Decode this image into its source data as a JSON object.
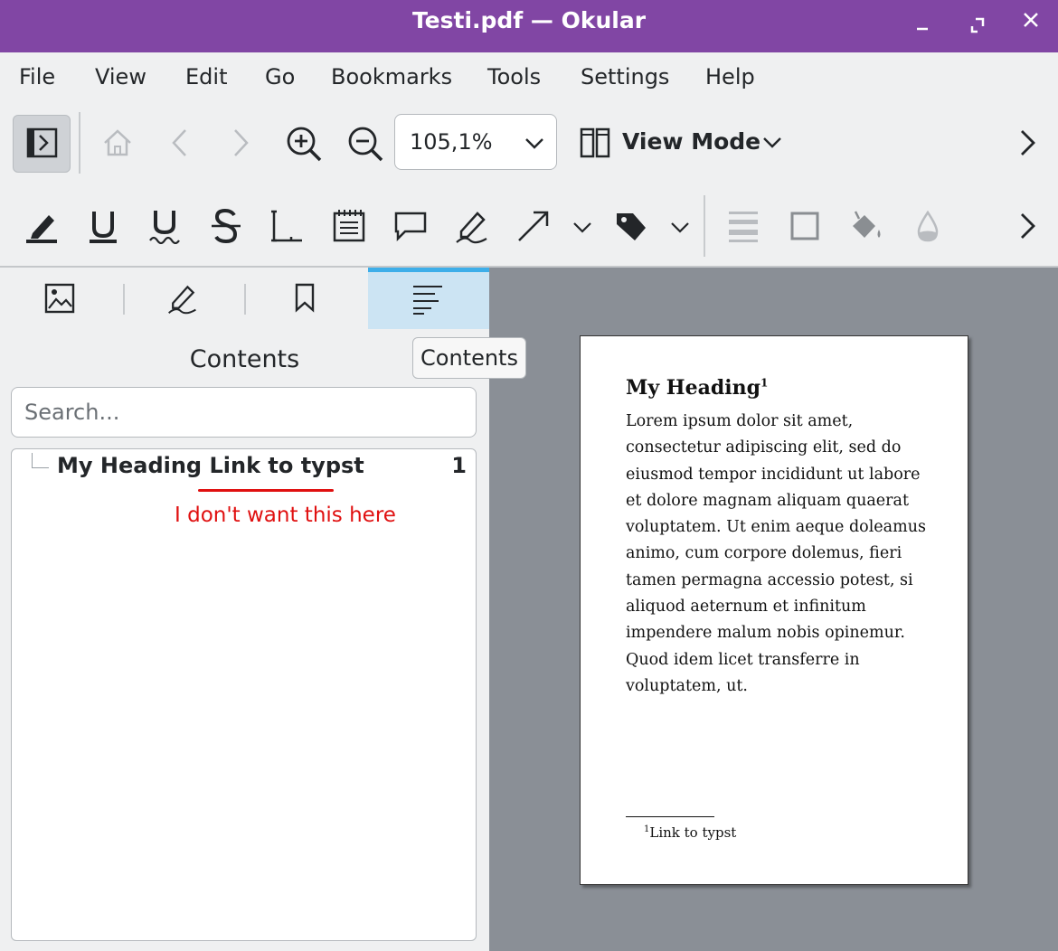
{
  "window": {
    "title": "Testi.pdf  — Okular",
    "colors": {
      "titlebar": "#8146a4",
      "accent": "#3daee9",
      "annotation": "#e01010"
    }
  },
  "menubar": {
    "items": [
      "File",
      "View",
      "Edit",
      "Go",
      "Bookmarks",
      "Tools",
      "Settings",
      "Help"
    ]
  },
  "main_toolbar": {
    "zoom": "105,1%",
    "view_mode_label": "View Mode",
    "icons": [
      "sidebar-toggle-icon",
      "home-icon",
      "back-icon",
      "forward-icon",
      "zoom-in-icon",
      "zoom-out-icon",
      "view-mode-icon",
      "overflow-icon"
    ]
  },
  "annotation_toolbar": {
    "icons": [
      "highlighter-icon",
      "underline-icon",
      "squiggle-icon",
      "strikeout-icon",
      "typewriter-icon",
      "inline-note-icon",
      "popup-note-icon",
      "freehand-icon",
      "arrow-icon",
      "stamp-icon",
      "line-width-icon",
      "border-color-icon",
      "fill-color-icon",
      "opacity-icon",
      "overflow-icon"
    ]
  },
  "sidebar": {
    "tabs": [
      "thumbnails",
      "reviews",
      "bookmarks",
      "contents"
    ],
    "active_tab": "contents",
    "title": "Contents",
    "search_placeholder": "Search...",
    "toc": [
      {
        "label": "My Heading Link to typst",
        "page": "1"
      }
    ],
    "annotation_note": "I don't want this here"
  },
  "tooltip": "Contents",
  "document": {
    "heading": "My Heading",
    "heading_footnote_mark": "1",
    "body": "Lorem ipsum dolor sit amet, consectetur adipiscing elit, sed do eiusmod tempor incididunt ut labore et dolore magnam aliquam quaerat voluptatem. Ut enim aeque doleamus animo, cum corpore dolemus, fieri tamen permagna accessio potest, si aliquod aeternum et infinitum impendere malum nobis opinemur. Quod idem licet transferre in voluptatem, ut.",
    "footnote_mark": "1",
    "footnote": "Link to typst"
  }
}
